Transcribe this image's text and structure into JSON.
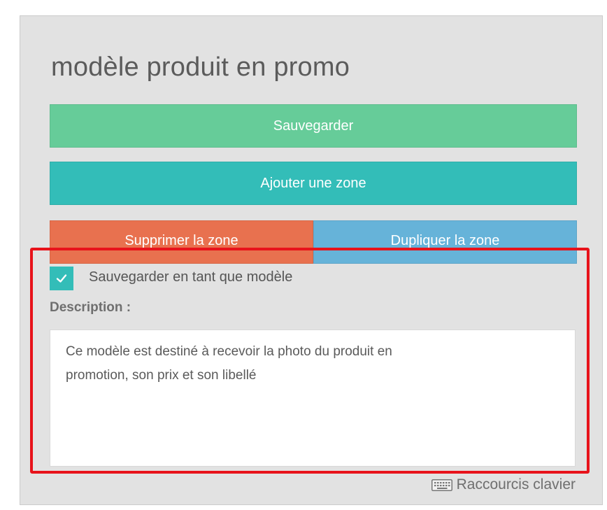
{
  "panel": {
    "title": "modèle produit en promo"
  },
  "buttons": {
    "save_label": "Sauvegarder",
    "add_zone_label": "Ajouter une zone",
    "delete_zone_label": "Supprimer la zone",
    "duplicate_zone_label": "Dupliquer la zone"
  },
  "template_checkbox": {
    "checked": true,
    "label": "Sauvegarder en tant que modèle"
  },
  "description": {
    "label": "Description :",
    "value": "Ce modèle est destiné à recevoir la photo du produit en\npromotion, son prix et son libellé"
  },
  "footer": {
    "shortcuts_label": "Raccourcis clavier",
    "shortcuts_icon": "keyboard-icon"
  },
  "colors": {
    "save": "#66cc99",
    "add": "#33bdb8",
    "delete": "#e8714f",
    "duplicate": "#66b3d9",
    "highlight": "#e8131b"
  }
}
